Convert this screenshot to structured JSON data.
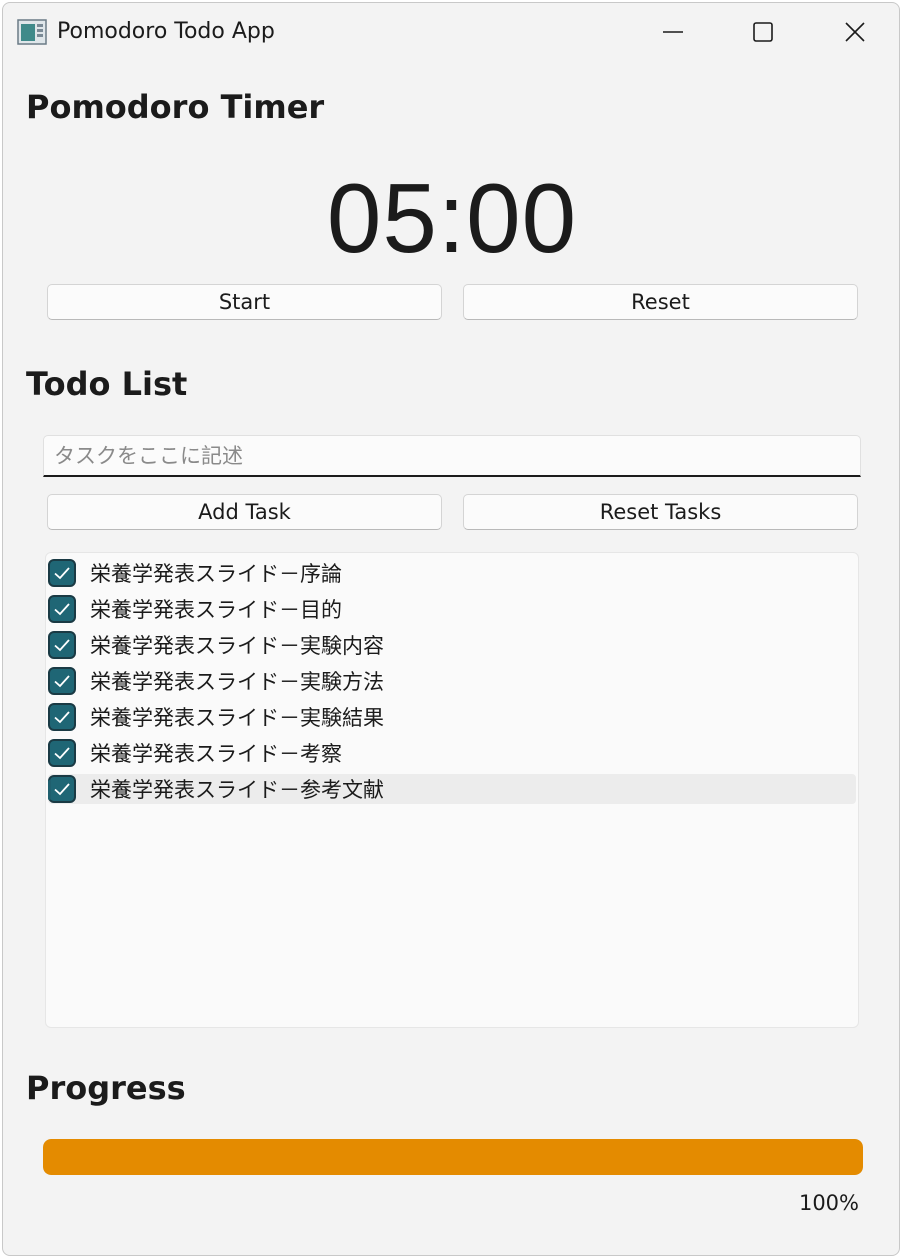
{
  "window": {
    "title": "Pomodoro Todo App",
    "icon": "app-window-icon",
    "caption_icons": [
      "minimize-icon",
      "maximize-icon",
      "close-icon"
    ]
  },
  "timer": {
    "heading": "Pomodoro Timer",
    "display": "05:00",
    "start_label": "Start",
    "reset_label": "Reset"
  },
  "todo": {
    "heading": "Todo List",
    "input_placeholder": "タスクをここに記述",
    "input_value": "",
    "add_label": "Add Task",
    "reset_label": "Reset Tasks",
    "items": [
      {
        "label": "栄養学発表スライド－序論",
        "checked": true
      },
      {
        "label": "栄養学発表スライド－目的",
        "checked": true
      },
      {
        "label": "栄養学発表スライド－実験内容",
        "checked": true
      },
      {
        "label": "栄養学発表スライド－実験方法",
        "checked": true
      },
      {
        "label": "栄養学発表スライド－実験結果",
        "checked": true
      },
      {
        "label": "栄養学発表スライド－考察",
        "checked": true
      },
      {
        "label": "栄養学発表スライド－参考文献",
        "checked": true,
        "selected": true
      }
    ]
  },
  "progress": {
    "heading": "Progress",
    "value": 100,
    "text": "100%"
  },
  "colors": {
    "accent_check": "#1f6675",
    "progress_fill": "#e48b00",
    "window_bg": "#f3f3f3"
  }
}
